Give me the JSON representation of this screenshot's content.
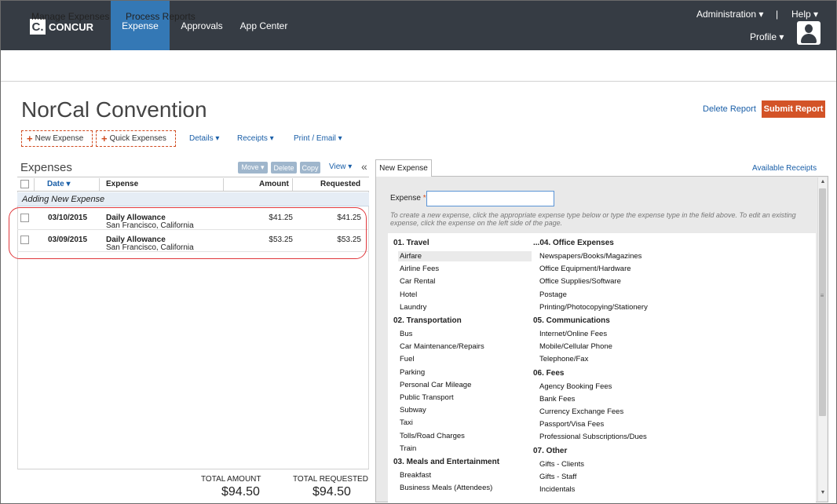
{
  "header": {
    "logo_mark": "C.",
    "logo_text": "CONCUR",
    "nav": [
      "Expense",
      "Approvals",
      "App Center"
    ],
    "administration": "Administration ▾",
    "separator": "|",
    "help": "Help ▾",
    "profile": "Profile ▾"
  },
  "subnav": {
    "manage": "Manage Expenses",
    "process": "Process Reports"
  },
  "report": {
    "title": "NorCal Convention",
    "delete": "Delete Report",
    "submit": "Submit Report",
    "new_expense": "New Expense",
    "quick_expenses": "Quick Expenses",
    "details": "Details ▾",
    "receipts": "Receipts ▾",
    "print_email": "Print / Email ▾"
  },
  "expenses": {
    "title": "Expenses",
    "move": "Move ▾",
    "delete": "Delete",
    "copy": "Copy",
    "view": "View ▾",
    "collapse": "«",
    "columns": {
      "date": "Date ▾",
      "expense": "Expense",
      "amount": "Amount",
      "requested": "Requested"
    },
    "adding": "Adding New Expense",
    "rows": [
      {
        "date": "03/10/2015",
        "type": "Daily Allowance",
        "location": "San Francisco, California",
        "amount": "$41.25",
        "requested": "$41.25"
      },
      {
        "date": "03/09/2015",
        "type": "Daily Allowance",
        "location": "San Francisco, California",
        "amount": "$53.25",
        "requested": "$53.25"
      }
    ],
    "total_amount_label": "TOTAL AMOUNT",
    "total_requested_label": "TOTAL REQUESTED",
    "total_amount": "$94.50",
    "total_requested": "$94.50"
  },
  "new_expense": {
    "tab": "New Expense",
    "available_receipts": "Available Receipts",
    "field_label": "Expense",
    "required_mark": "*",
    "input_value": "",
    "hint": "To create a new expense, click the appropriate expense type below or type the expense type in the field above. To edit an existing expense, click the expense on the left side of the page.",
    "col1": [
      {
        "cat": "01. Travel",
        "items": [
          "Airfare",
          "Airline Fees",
          "Car Rental",
          "Hotel",
          "Laundry"
        ]
      },
      {
        "cat": "02. Transportation",
        "items": [
          "Bus",
          "Car Maintenance/Repairs",
          "Fuel",
          "Parking",
          "Personal Car Mileage",
          "Public Transport",
          "Subway",
          "Taxi",
          "Tolls/Road Charges",
          "Train"
        ]
      },
      {
        "cat": "03. Meals and Entertainment",
        "items": [
          "Breakfast",
          "Business Meals (Attendees)"
        ]
      }
    ],
    "col2": [
      {
        "cat": "...04. Office Expenses",
        "items": [
          "Newspapers/Books/Magazines",
          "Office Equipment/Hardware",
          "Office Supplies/Software",
          "Postage",
          "Printing/Photocopying/Stationery"
        ]
      },
      {
        "cat": "05. Communications",
        "items": [
          "Internet/Online Fees",
          "Mobile/Cellular Phone",
          "Telephone/Fax"
        ]
      },
      {
        "cat": "06. Fees",
        "items": [
          "Agency Booking Fees",
          "Bank Fees",
          "Currency Exchange Fees",
          "Passport/Visa Fees",
          "Professional Subscriptions/Dues"
        ]
      },
      {
        "cat": "07. Other",
        "items": [
          "Gifts - Clients",
          "Gifts - Staff",
          "Incidentals"
        ]
      }
    ],
    "scroll_up": "▲",
    "scroll_grip": "≡",
    "scroll_down": "▼"
  }
}
